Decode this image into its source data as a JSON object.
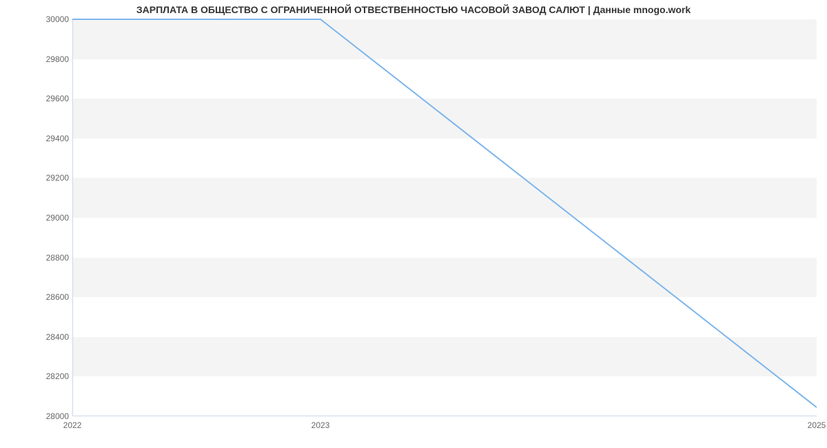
{
  "chart_data": {
    "type": "line",
    "title": "ЗАРПЛАТА В ОБЩЕСТВО С ОГРАНИЧЕННОЙ ОТВЕСТВЕННОСТЬЮ ЧАСОВОЙ ЗАВОД САЛЮТ | Данные mnogo.work",
    "x": [
      2022,
      2023,
      2025
    ],
    "y": [
      30000,
      30000,
      28045
    ],
    "xlabel": "",
    "ylabel": "",
    "ylim": [
      28000,
      30000
    ],
    "xlim": [
      2022,
      2025
    ],
    "y_ticks": [
      28000,
      28200,
      28400,
      28600,
      28800,
      29000,
      29200,
      29400,
      29600,
      29800,
      30000
    ],
    "x_ticks": [
      2022,
      2023,
      2025
    ]
  },
  "colors": {
    "line": "#7cb5ec",
    "band": "#f4f4f4",
    "axis": "#ccd6eb"
  }
}
